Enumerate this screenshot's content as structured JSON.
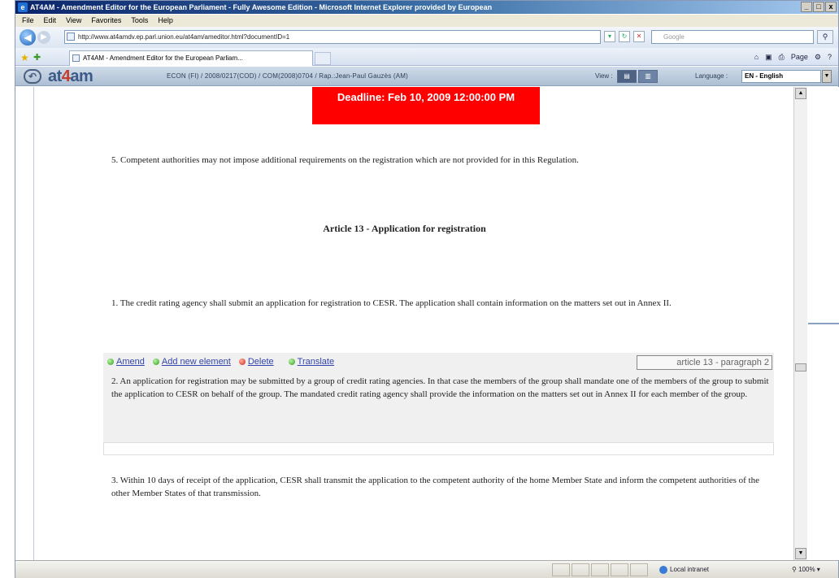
{
  "window": {
    "title": "AT4AM - Amendment Editor for the European Parliament - Fully Awesome Edition - Microsoft Internet Explorer provided by European",
    "buttons": [
      "_",
      "□",
      "x"
    ]
  },
  "menu": [
    "File",
    "Edit",
    "View",
    "Favorites",
    "Tools",
    "Help"
  ],
  "address": {
    "url": "http://www.at4amdv.ep.parl.union.eu/at4am/ameditor.html?documentID=1",
    "search_placeholder": "Google"
  },
  "tab": {
    "label": "AT4AM - Amendment Editor for the European Parliam..."
  },
  "commandbar": {
    "page_label": "Page",
    "tools_label": "⚙"
  },
  "app": {
    "logo_prefix": "at",
    "logo_four": "4",
    "logo_suffix": "am",
    "doc_ref": "ECON (FI) / 2008/0217(COD) / COM(2008)0704 / Rap.:Jean-Paul Gauzès (AM)",
    "view_label": "View :",
    "language_label": "Language :",
    "language_value": "EN - English"
  },
  "document": {
    "deadline": "Deadline: Feb 10, 2009 12:00:00 PM",
    "para5": "5. Competent authorities may not impose additional requirements on the registration which are not provided for in this Regulation.",
    "article_title": "Article 13 - Application for registration",
    "para1": "1. The credit rating agency shall submit an application for registration to CESR. The application shall contain information on the matters set out in Annex II.",
    "actions": {
      "amend": "Amend",
      "add": "Add new element",
      "delete": "Delete",
      "translate": "Translate"
    },
    "ref": "article 13 - paragraph 2",
    "para2": "2. An application for registration may be submitted by a group of credit rating agencies. In that case the members of the group shall mandate one of the members of the group to submit the application to CESR on behalf of the group. The mandated credit rating agency shall provide the information on the matters set out in Annex II for each member of the group.",
    "para3": "3. Within 10 days of receipt of the application, CESR shall transmit the application to the competent authority of the home Member State and inform the competent authorities of the other Member States of that transmission."
  },
  "status": {
    "zone": "Local intranet",
    "zoom": "100%"
  }
}
